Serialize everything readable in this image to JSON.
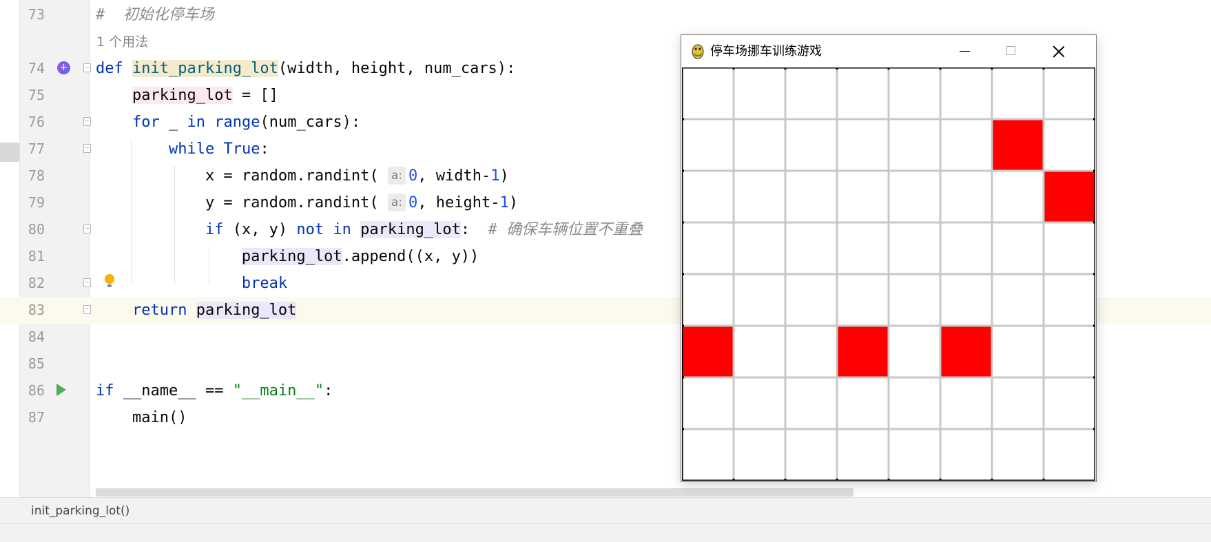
{
  "editor": {
    "usages_hint": "1 个用法",
    "breadcrumb": "init_parking_lot()",
    "lines": [
      {
        "n": "73",
        "segs": [
          [
            "cm",
            "#  初始化停车场"
          ]
        ]
      },
      {
        "n": "74",
        "segs": [
          [
            "kw",
            "def"
          ],
          [
            "",
            " "
          ],
          [
            "fn-decl",
            "init_parking_lot"
          ],
          [
            "",
            "(width, height, num_cars):"
          ]
        ]
      },
      {
        "n": "75",
        "segs": [
          [
            "",
            "    "
          ],
          [
            "hl-var",
            "parking_lot"
          ],
          [
            "",
            " = []"
          ]
        ]
      },
      {
        "n": "76",
        "segs": [
          [
            "",
            "    "
          ],
          [
            "kw",
            "for"
          ],
          [
            "",
            " _ "
          ],
          [
            "kw",
            "in"
          ],
          [
            "",
            " "
          ],
          [
            "kw",
            "range"
          ],
          [
            "",
            "(num_cars):"
          ]
        ]
      },
      {
        "n": "77",
        "segs": [
          [
            "",
            "        "
          ],
          [
            "kw",
            "while"
          ],
          [
            "",
            " "
          ],
          [
            "kw",
            "True"
          ],
          [
            "",
            ":"
          ]
        ]
      },
      {
        "n": "78",
        "segs": [
          [
            "",
            "            x = random.randint( "
          ],
          [
            "hint",
            "a:"
          ],
          [
            "num",
            "0"
          ],
          [
            "",
            ", width-"
          ],
          [
            "num",
            "1"
          ],
          [
            "",
            ")"
          ]
        ]
      },
      {
        "n": "79",
        "segs": [
          [
            "",
            "            y = random.randint( "
          ],
          [
            "hint",
            "a:"
          ],
          [
            "num",
            "0"
          ],
          [
            "",
            ", height-"
          ],
          [
            "num",
            "1"
          ],
          [
            "",
            ")"
          ]
        ]
      },
      {
        "n": "80",
        "segs": [
          [
            "",
            "            "
          ],
          [
            "kw",
            "if"
          ],
          [
            "",
            " (x, y) "
          ],
          [
            "kw",
            "not in"
          ],
          [
            "",
            " "
          ],
          [
            "hl-ref",
            "parking_lot"
          ],
          [
            "",
            ":  "
          ],
          [
            "cm",
            "# 确保车辆位置不重叠"
          ]
        ]
      },
      {
        "n": "81",
        "segs": [
          [
            "",
            "                "
          ],
          [
            "hl-ref",
            "parking_lot"
          ],
          [
            "",
            ".append((x, y))"
          ]
        ]
      },
      {
        "n": "82",
        "segs": [
          [
            "",
            "                "
          ],
          [
            "kw",
            "break"
          ]
        ]
      },
      {
        "n": "83",
        "segs": [
          [
            "",
            "    "
          ],
          [
            "kw",
            "return"
          ],
          [
            "",
            " "
          ],
          [
            "hl-ref",
            "parking_lot"
          ]
        ]
      },
      {
        "n": "84",
        "segs": []
      },
      {
        "n": "85",
        "segs": []
      },
      {
        "n": "86",
        "segs": [
          [
            "kw",
            "if"
          ],
          [
            "",
            " __name__ == "
          ],
          [
            "str",
            "\"__main__\""
          ],
          [
            "",
            ":"
          ]
        ]
      },
      {
        "n": "87",
        "segs": [
          [
            "",
            "    main()"
          ]
        ]
      }
    ]
  },
  "game_window": {
    "title": "停车场挪车训练游戏",
    "grid_size": 8,
    "grid_line_color": "#c8c8c8",
    "car_color": "#ff0000",
    "cars": [
      [
        6,
        1
      ],
      [
        7,
        2
      ],
      [
        0,
        5
      ],
      [
        3,
        5
      ],
      [
        5,
        5
      ]
    ]
  }
}
